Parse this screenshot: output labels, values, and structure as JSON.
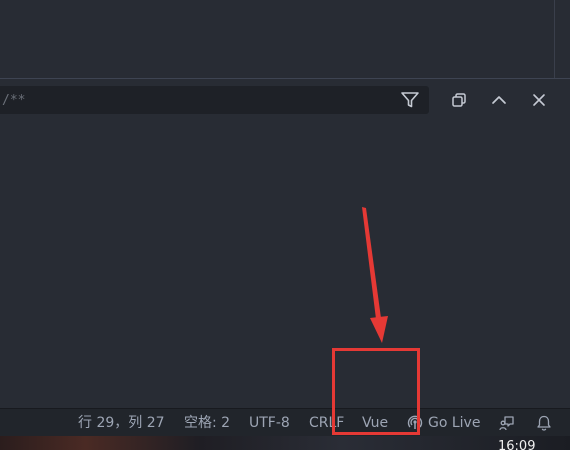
{
  "filter": {
    "placeholder": "/**"
  },
  "panel_actions": [
    {
      "name": "filter-icon"
    },
    {
      "name": "restore-panel-icon"
    },
    {
      "name": "maximize-panel-icon"
    },
    {
      "name": "close-panel-icon"
    }
  ],
  "statusbar": {
    "position": "行 29，列 27",
    "indentation": "空格: 2",
    "encoding": "UTF-8",
    "line_ending": "CRLF",
    "language": "Vue",
    "go_live": "Go Live"
  },
  "taskbar": {
    "clock": "16:09"
  },
  "colors": {
    "background": "#282c34",
    "statusbar": "#21252b",
    "text": "#9da5b4",
    "annotation": "#e53935"
  }
}
